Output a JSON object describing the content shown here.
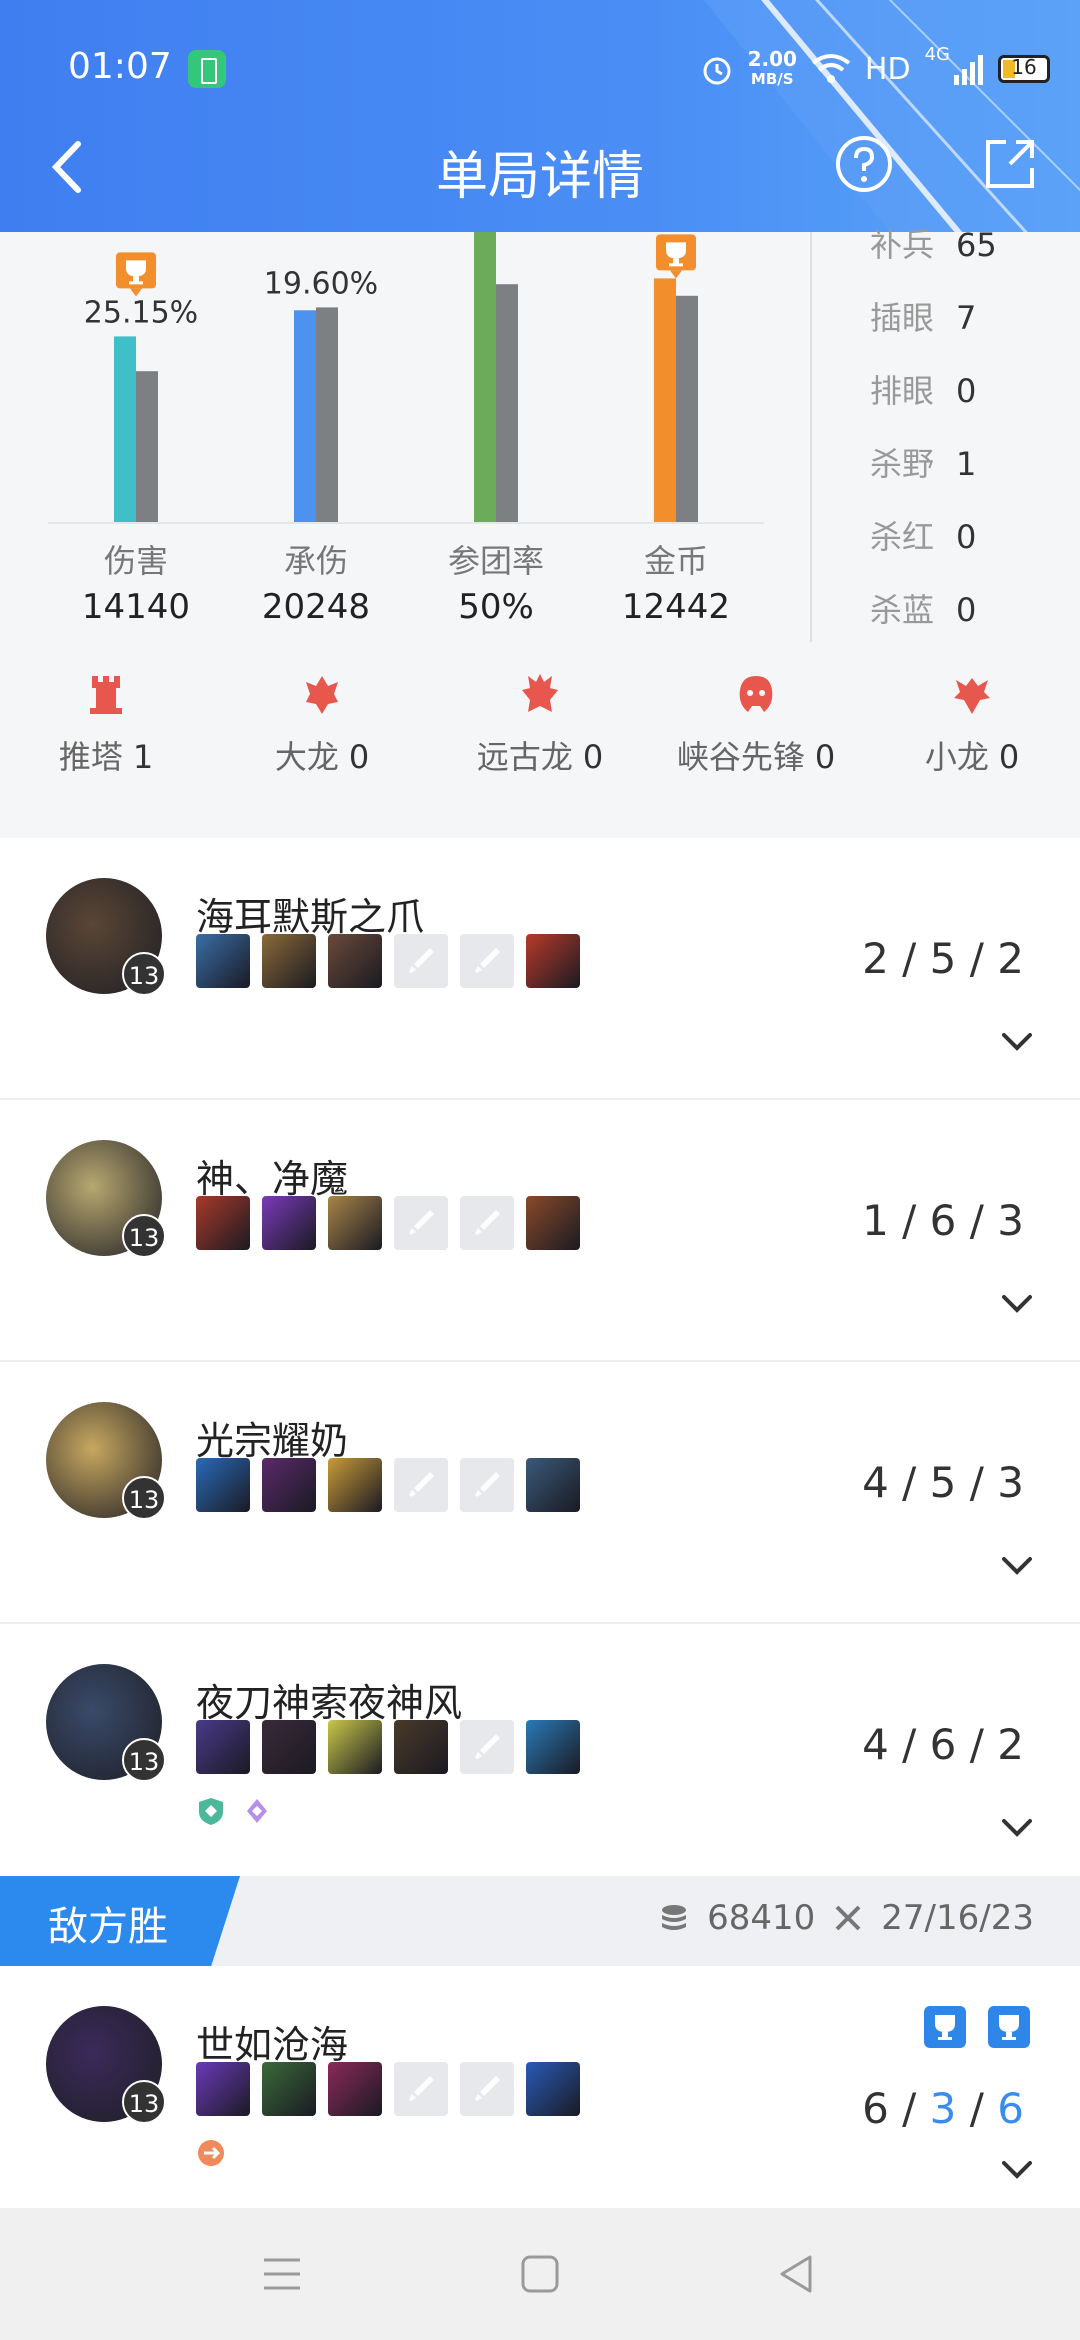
{
  "status_bar": {
    "time": "01:07",
    "net_speed_value": "2.00",
    "net_speed_unit": "MB/S",
    "hd": "HD",
    "network": "4G",
    "battery": "16"
  },
  "nav": {
    "title": "单局详情",
    "icons": [
      "back-arrow-icon",
      "help-icon",
      "share-icon"
    ]
  },
  "chart_data": {
    "type": "bar",
    "categories": [
      "伤害",
      "承伤",
      "参团率",
      "金币"
    ],
    "category_values": [
      "14140",
      "20248",
      "50%",
      "12442"
    ],
    "data_labels": [
      "25.15%",
      "19.60%",
      "",
      ""
    ],
    "trophy_on": [
      true,
      false,
      false,
      true
    ],
    "series": [
      {
        "values": [
          0.64,
          0.73,
          1.0,
          0.84
        ],
        "color": [
          "#3fbfc7",
          "#4b93ee",
          "#6bab5a",
          "#f28e2b"
        ]
      },
      {
        "values": [
          0.52,
          0.74,
          0.82,
          0.78
        ],
        "color": "#7c8083"
      }
    ]
  },
  "side_stats": [
    {
      "label": "补兵",
      "value": "65"
    },
    {
      "label": "插眼",
      "value": "7"
    },
    {
      "label": "排眼",
      "value": "0"
    },
    {
      "label": "杀野",
      "value": "1"
    },
    {
      "label": "杀红",
      "value": "0"
    },
    {
      "label": "杀蓝",
      "value": "0"
    }
  ],
  "objectives": [
    {
      "label": "推塔",
      "value": "1",
      "icon": "tower-icon"
    },
    {
      "label": "大龙",
      "value": "0",
      "icon": "baron-icon"
    },
    {
      "label": "远古龙",
      "value": "0",
      "icon": "elder-dragon-icon"
    },
    {
      "label": "峡谷先锋",
      "value": "0",
      "icon": "herald-icon"
    },
    {
      "label": "小龙",
      "value": "0",
      "icon": "dragon-icon"
    }
  ],
  "players": [
    {
      "name": "海耳默斯之爪",
      "level": "13",
      "kda": [
        "2",
        "5",
        "2"
      ],
      "items": [
        "#3a6ea8",
        "#8b6a3a",
        "#6a4a3a",
        "",
        "",
        "#b83a2a"
      ],
      "avatar": "#5a4636"
    },
    {
      "name": "神、净魔",
      "level": "13",
      "kda": [
        "1",
        "6",
        "3"
      ],
      "items": [
        "#a83a2a",
        "#7a3ab8",
        "#a8844a",
        "",
        "",
        "#8a4a2a"
      ],
      "avatar": "#b8a870"
    },
    {
      "name": "光宗耀奶",
      "level": "13",
      "kda": [
        "4",
        "5",
        "3"
      ],
      "items": [
        "#2a6ab8",
        "#5a2a6a",
        "#c89a3a",
        "",
        "",
        "#3a5a7a"
      ],
      "avatar": "#c8a860"
    },
    {
      "name": "夜刀神索夜神风",
      "level": "13",
      "kda": [
        "4",
        "6",
        "2"
      ],
      "items": [
        "#4a3a8a",
        "#3a2a3a",
        "#c8c84a",
        "#4a3a2a",
        "",
        "#2a7ab8"
      ],
      "avatar": "#3a4a6a",
      "badges": [
        "shield-badge-icon",
        "crystal-badge-icon"
      ]
    }
  ],
  "enemy_team": {
    "result": "敌方胜",
    "gold": "68410",
    "kda": "27/16/23",
    "icons": [
      "gold-coins-icon",
      "crossed-swords-icon"
    ]
  },
  "enemy_players": [
    {
      "name": "世如沧海",
      "level": "13",
      "kda": [
        "6",
        "3",
        "6"
      ],
      "items": [
        "#6a3ab8",
        "#3a6a3a",
        "#8a2a5a",
        "",
        "",
        "#2a5ab8"
      ],
      "avatar": "#3a2a5a",
      "badges": [
        "orange-badge-icon"
      ],
      "trophies": 2
    }
  ],
  "colors": {
    "accent": "#3f7ef0",
    "trophy": "#f28e2b",
    "enemy_tag": "#2c8aef",
    "objective_icon": "#e8574e"
  }
}
